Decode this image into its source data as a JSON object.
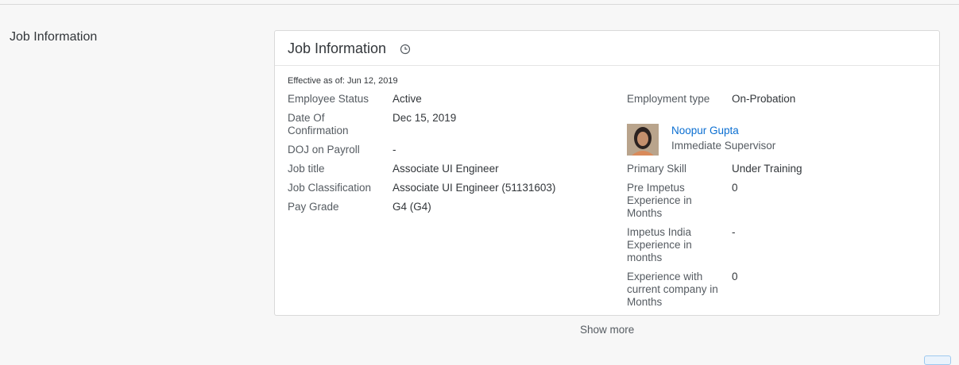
{
  "section": {
    "label": "Job Information"
  },
  "card": {
    "title": "Job Information",
    "effective": "Effective as of: Jun 12, 2019",
    "left_fields": [
      {
        "label": "Employee Status",
        "value": "Active"
      },
      {
        "label": "Date Of Confirmation",
        "value": "Dec 15, 2019"
      },
      {
        "label": "DOJ on Payroll",
        "value": "-"
      },
      {
        "label": "Job title",
        "value": "Associate UI Engineer"
      },
      {
        "label": "Job Classification",
        "value": "Associate UI Engineer (51131603)"
      },
      {
        "label": "Pay Grade",
        "value": "G4 (G4)"
      }
    ],
    "employment_type": {
      "label": "Employment type",
      "value": "On-Probation"
    },
    "supervisor": {
      "name": "Noopur Gupta",
      "role": "Immediate Supervisor"
    },
    "right_fields": [
      {
        "label": "Primary Skill",
        "value": "Under Training"
      },
      {
        "label": "Pre Impetus Experience in Months",
        "value": "0"
      },
      {
        "label": "Impetus India Experience in months",
        "value": "-"
      },
      {
        "label": "Experience with current company in Months",
        "value": "0"
      }
    ]
  },
  "show_more": "Show more",
  "colors": {
    "link": "#0a6ed1",
    "text": "#32363a",
    "label": "#555b61",
    "border": "#d9d9d9"
  }
}
